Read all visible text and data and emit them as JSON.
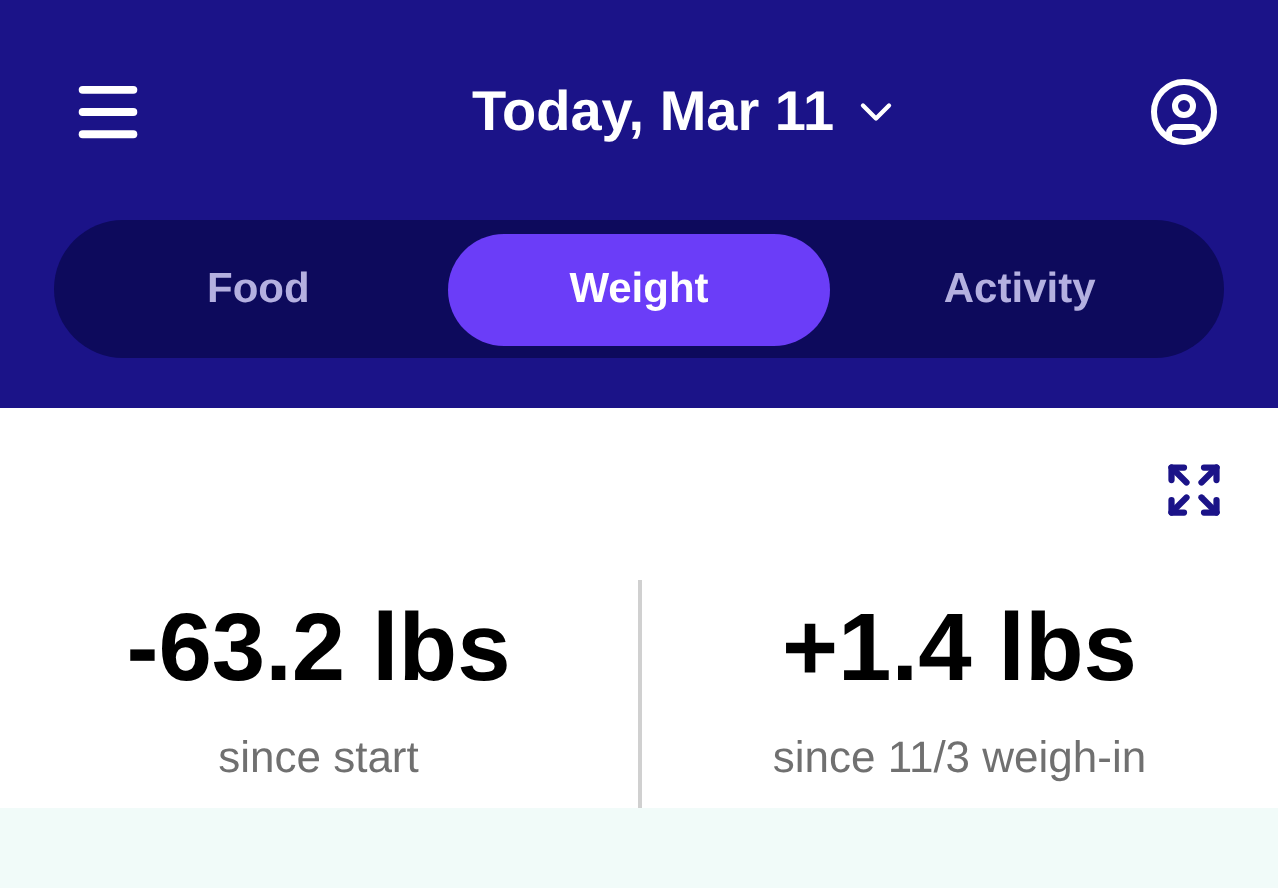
{
  "header": {
    "title": "Today, Mar 11"
  },
  "tabs": [
    {
      "label": "Food",
      "selected": false
    },
    {
      "label": "Weight",
      "selected": true
    },
    {
      "label": "Activity",
      "selected": false
    }
  ],
  "stats": [
    {
      "value": "-63.2 lbs",
      "caption": "since start"
    },
    {
      "value": "+1.4 lbs",
      "caption": "since 11/3 weigh-in"
    }
  ]
}
